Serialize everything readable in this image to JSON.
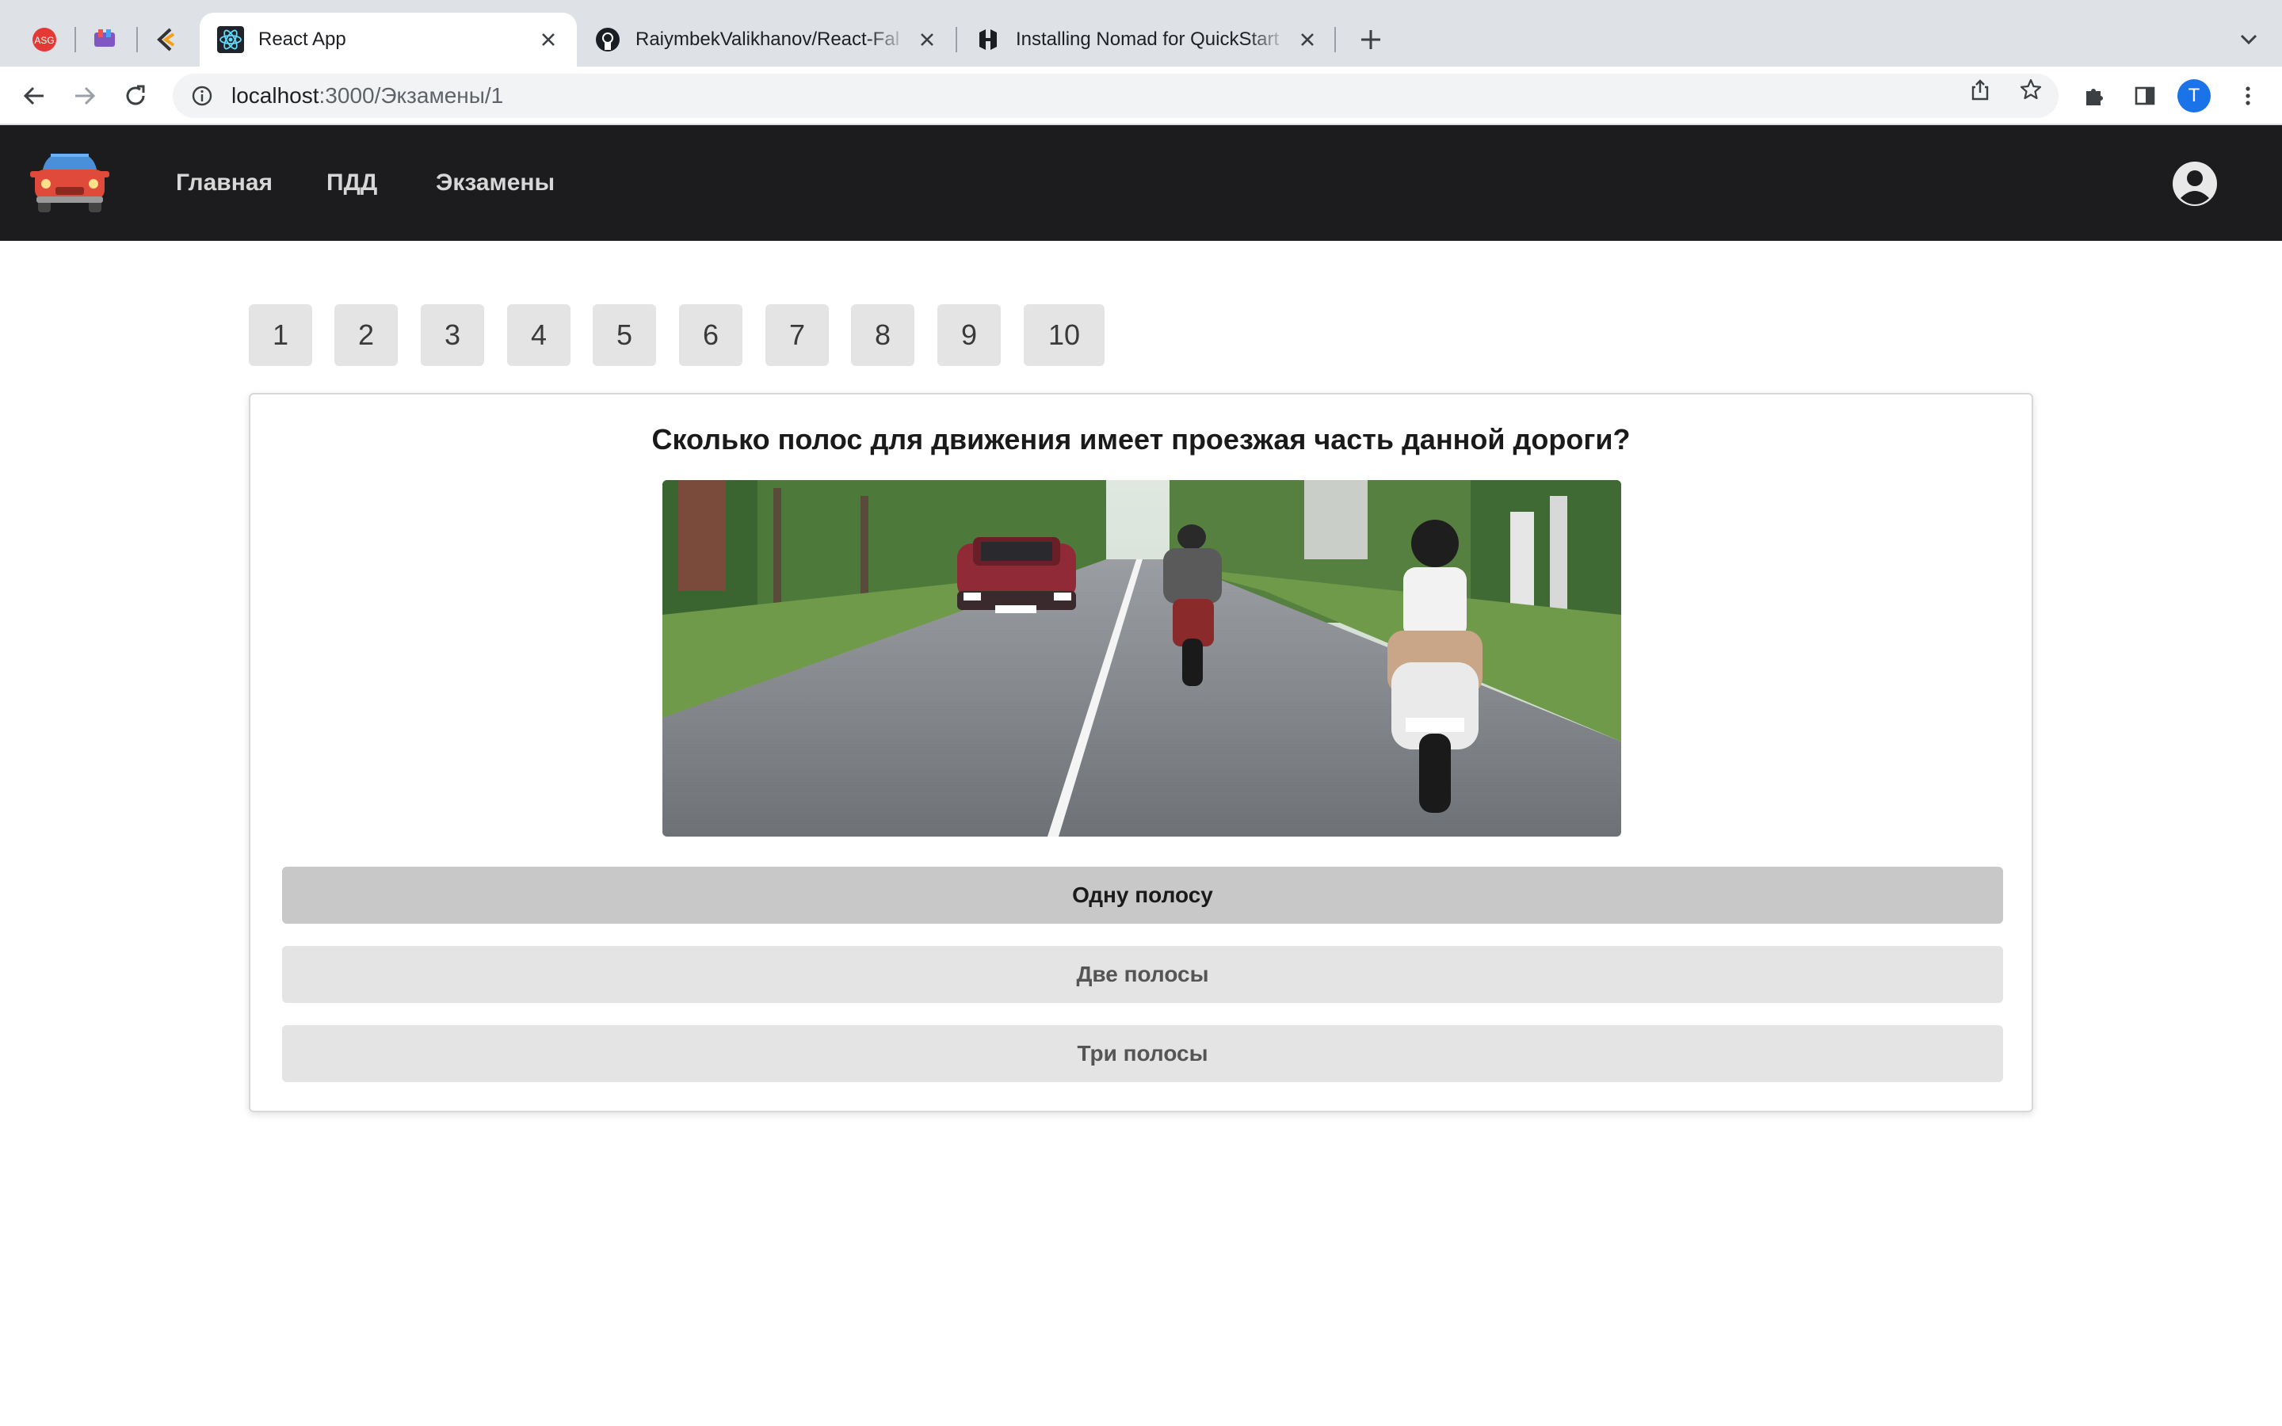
{
  "browser": {
    "tabs": [
      {
        "title": "React App",
        "active": true,
        "favicon": "react-icon"
      },
      {
        "title": "RaiymbekValikhanov/React-Fal",
        "active": false,
        "favicon": "github-icon"
      },
      {
        "title": "Installing Nomad for QuickStart",
        "active": false,
        "favicon": "hashicorp-icon"
      }
    ],
    "pinned_tabs": [
      "pinned-app-icon",
      "pinned-app-icon",
      "pinned-app-icon"
    ],
    "url_host": "localhost",
    "url_path": ":3000/Экзамены/1",
    "profile_initial": "T"
  },
  "navbar": {
    "links": [
      "Главная",
      "ПДД",
      "Экзамены"
    ]
  },
  "question_numbers": [
    "1",
    "2",
    "3",
    "4",
    "5",
    "6",
    "7",
    "8",
    "9",
    "10"
  ],
  "question": {
    "text": "Сколько полос для движения имеет проезжая часть данной дороги?",
    "answers": [
      "Одну полосу",
      "Две полосы",
      "Три полосы"
    ],
    "selected_index": 0
  },
  "colors": {
    "navbar_bg": "#1c1c1f",
    "question_button_bg": "#e4e4e4",
    "answer_selected_bg": "#c8c8c8"
  }
}
